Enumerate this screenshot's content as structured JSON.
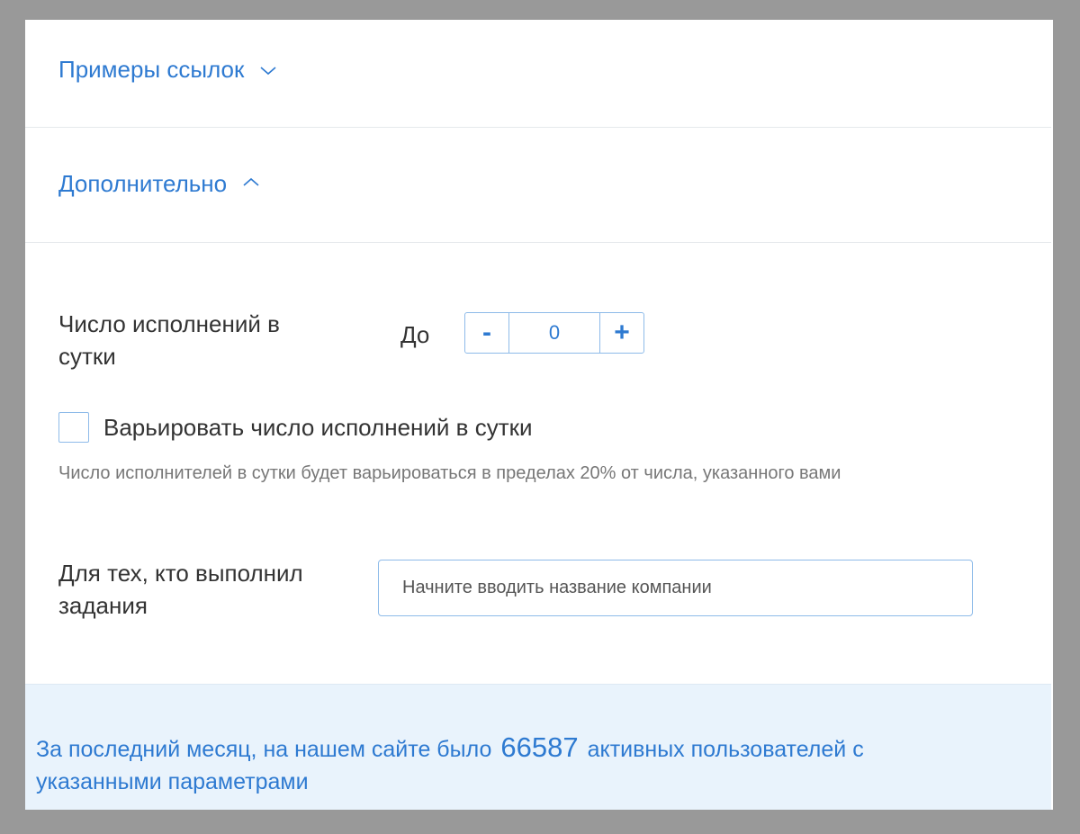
{
  "sections": {
    "examples": {
      "label": "Примеры ссылок",
      "icon": "chevron-down-icon"
    },
    "additional": {
      "label": "Дополнительно",
      "icon": "chevron-up-icon"
    }
  },
  "executions": {
    "label_line1": "Число исполнений в",
    "label_line2": "сутки",
    "upto_label": "До",
    "minus_label": "-",
    "plus_label": "+",
    "value": "0"
  },
  "vary": {
    "checked": false,
    "label": "Варьировать число исполнений в сутки",
    "hint": "Число исполнителей в сутки будет варьироваться в пределах 20% от числа, указанного вами"
  },
  "completed": {
    "label_line1": "Для тех, кто выполнил",
    "label_line2": "задания",
    "placeholder": "Начните вводить название компании",
    "value": ""
  },
  "footer": {
    "text_before": "За последний месяц, на нашем сайте было",
    "count": "66587",
    "text_after": "активных пользователей с указанными параметрами"
  },
  "colors": {
    "accent": "#2e7ad1",
    "border": "#8ebbe9",
    "footer_bg": "#e9f3fc",
    "backdrop": "#999999"
  }
}
